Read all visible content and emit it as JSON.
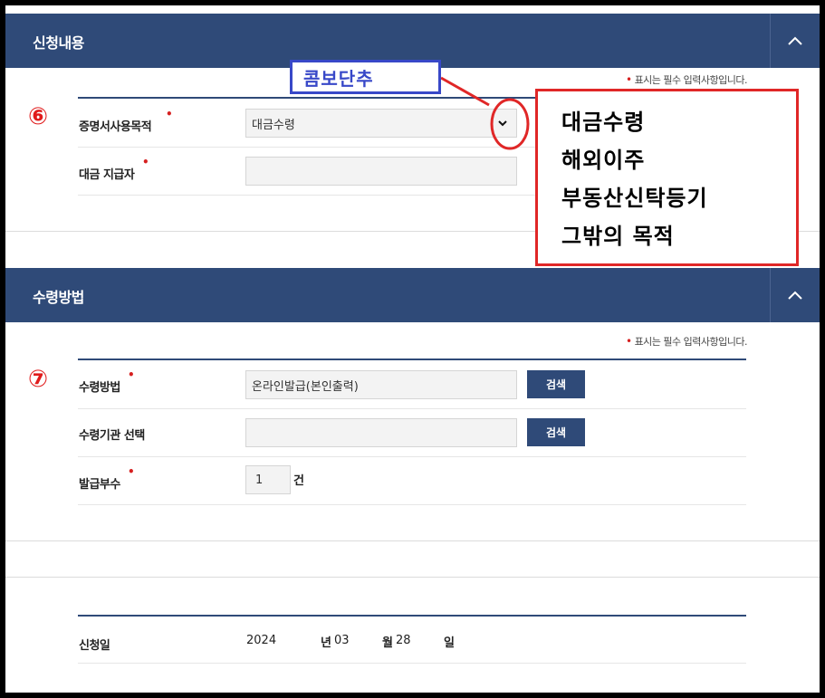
{
  "section1": {
    "title": "신청내용",
    "required_note": "표시는 필수 입력사항입니다.",
    "step": "⑥",
    "purpose_label": "증명서사용목적",
    "purpose_value": "대금수령",
    "payer_label": "대금 지급자",
    "payer_value": ""
  },
  "section2": {
    "title": "수령방법",
    "required_note": "표시는 필수 입력사항입니다.",
    "step": "⑦",
    "method_label": "수령방법",
    "method_value": "온라인발급(본인출력)",
    "search_label": "검색",
    "agency_label": "수령기관 선택",
    "agency_value": "",
    "copies_label": "발급부수",
    "copies_value": "1",
    "copies_unit": "건"
  },
  "section3": {
    "date_label": "신청일",
    "year": "2024",
    "year_unit": "년",
    "month": "03",
    "month_unit": "월",
    "day": "28",
    "day_unit": "일"
  },
  "annotations": {
    "combo_label": "콤보단추",
    "options": [
      "대금수령",
      "해외이주",
      "부동산신탁등기",
      "그밖의 목적"
    ]
  },
  "colors": {
    "header_bg": "#2f4a78",
    "required_dot": "#d62020",
    "annotation_red": "#e02727",
    "annotation_blue": "#3848c8"
  }
}
